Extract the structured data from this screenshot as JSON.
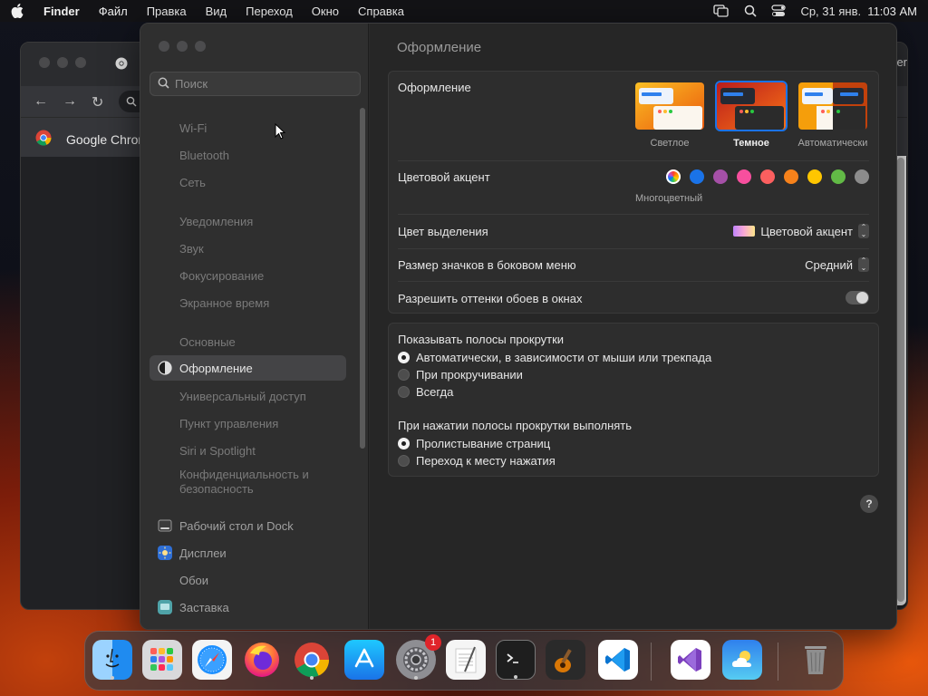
{
  "menubar": {
    "app_name": "Finder",
    "items": [
      "Файл",
      "Правка",
      "Вид",
      "Переход",
      "Окно",
      "Справка"
    ],
    "clock": "Ср, 31 янв.  11:03 AM"
  },
  "chrome": {
    "bookmark_label": "Google Chrom",
    "edge_text": "er"
  },
  "settings": {
    "search_placeholder": "Поиск",
    "sidebar": [
      {
        "label": "Wi-Fi",
        "icon": "wifi-icon"
      },
      {
        "label": "Bluetooth",
        "icon": "bluetooth-icon"
      },
      {
        "label": "Сеть",
        "icon": "network-icon"
      },
      {
        "label": "Уведомления",
        "icon": "notifications-icon"
      },
      {
        "label": "Звук",
        "icon": "sound-icon"
      },
      {
        "label": "Фокусирование",
        "icon": "focus-icon"
      },
      {
        "label": "Экранное время",
        "icon": "screen-time-icon"
      },
      {
        "label": "Основные",
        "icon": "general-icon"
      },
      {
        "label": "Оформление",
        "icon": "appearance-icon"
      },
      {
        "label": "Универсальный доступ",
        "icon": "accessibility-icon"
      },
      {
        "label": "Пункт управления",
        "icon": "control-center-icon"
      },
      {
        "label": "Siri и Spotlight",
        "icon": "siri-icon"
      },
      {
        "label": "Конфиденциальность и безопасность",
        "icon": "privacy-icon"
      },
      {
        "label": "Рабочий стол и Dock",
        "icon": "desktop-dock-icon"
      },
      {
        "label": "Дисплеи",
        "icon": "displays-icon"
      },
      {
        "label": "Обои",
        "icon": "wallpaper-icon"
      },
      {
        "label": "Заставка",
        "icon": "screensaver-icon"
      }
    ],
    "main": {
      "title": "Оформление",
      "appearance_label": "Оформление",
      "appearance_options": [
        "Светлое",
        "Темное",
        "Автоматически"
      ],
      "appearance_selected": "Темное",
      "accent_label": "Цветовой акцент",
      "accent_colors": [
        "multicolor",
        "#1a73e8",
        "#a550a7",
        "#f74f9e",
        "#fc5f5f",
        "#f7821b",
        "#ffc600",
        "#62ba46",
        "#8c8c8c"
      ],
      "accent_selected_label": "Многоцветный",
      "highlight_label": "Цвет выделения",
      "highlight_value": "Цветовой акцент",
      "icon_size_label": "Размер значков в боковом меню",
      "icon_size_value": "Средний",
      "wallpaper_tint_label": "Разрешить оттенки обоев в окнах",
      "wallpaper_tint_on": false,
      "scrollbars_label": "Показывать полосы прокрутки",
      "scrollbar_options": [
        "Автоматически, в зависимости от мыши или трекпада",
        "При прокручивании",
        "Всегда"
      ],
      "scrollbar_selected": 0,
      "click_label": "При нажатии полосы прокрутки выполнять",
      "click_options": [
        "Пролистывание страниц",
        "Переход к месту нажатия"
      ],
      "click_selected": 0,
      "help": "?"
    }
  },
  "dock": {
    "apps": [
      "finder-icon",
      "launchpad-icon",
      "safari-icon",
      "firefox-icon",
      "chrome-icon",
      "app-store-icon",
      "system-settings-icon",
      "textedit-icon",
      "terminal-icon",
      "garageband-icon",
      "vscode-icon",
      "visual-studio-icon",
      "weather-icon",
      "trash-icon"
    ],
    "settings_badge": "1"
  }
}
